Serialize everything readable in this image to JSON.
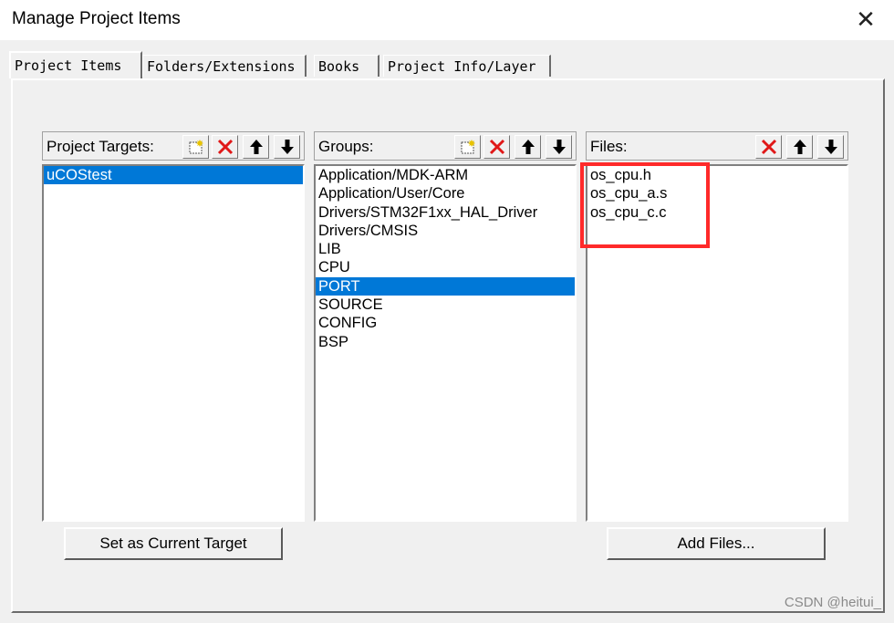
{
  "window": {
    "title": "Manage Project Items",
    "close_glyph": "✕"
  },
  "tabs": [
    {
      "label": "Project Items",
      "active": true
    },
    {
      "label": "Folders/Extensions",
      "active": false
    },
    {
      "label": "Books",
      "active": false
    },
    {
      "label": "Project Info/Layer",
      "active": false
    }
  ],
  "targets": {
    "label": "Project Targets:",
    "items": [
      {
        "label": "uCOStest",
        "selected": true
      }
    ],
    "button_label": "Set as Current Target"
  },
  "groups": {
    "label": "Groups:",
    "items": [
      {
        "label": "Application/MDK-ARM"
      },
      {
        "label": "Application/User/Core"
      },
      {
        "label": "Drivers/STM32F1xx_HAL_Driver"
      },
      {
        "label": "Drivers/CMSIS"
      },
      {
        "label": "LIB"
      },
      {
        "label": "CPU"
      },
      {
        "label": "PORT",
        "selected": true
      },
      {
        "label": "SOURCE"
      },
      {
        "label": "CONFIG"
      },
      {
        "label": "BSP"
      }
    ]
  },
  "files": {
    "label": "Files:",
    "items": [
      {
        "label": "os_cpu.h"
      },
      {
        "label": "os_cpu_a.s"
      },
      {
        "label": "os_cpu_c.c"
      }
    ],
    "button_label": "Add Files..."
  },
  "colors": {
    "selection": "#0078d7",
    "highlight_box": "#ff2a2a",
    "delete_icon": "#e01818"
  },
  "watermark": "CSDN @heitui_"
}
